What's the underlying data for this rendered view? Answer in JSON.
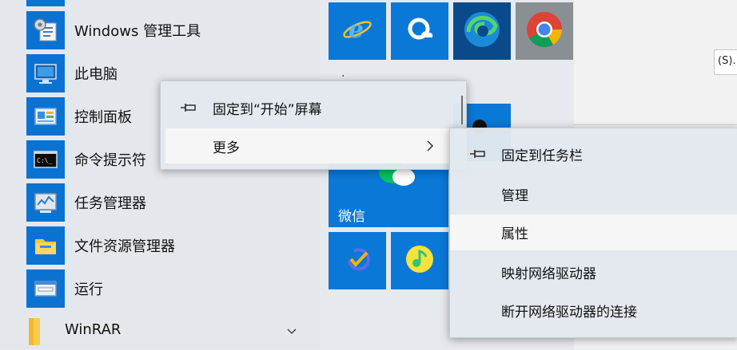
{
  "start_list": {
    "items": [
      {
        "label": "Windows 管理工具",
        "icon": "admin-tools-icon"
      },
      {
        "label": "此电脑",
        "icon": "this-pc-icon"
      },
      {
        "label": "控制面板",
        "icon": "control-panel-icon"
      },
      {
        "label": "命令提示符",
        "icon": "command-prompt-icon"
      },
      {
        "label": "任务管理器",
        "icon": "task-manager-icon"
      },
      {
        "label": "文件资源管理器",
        "icon": "file-explorer-icon"
      },
      {
        "label": "运行",
        "icon": "run-icon"
      }
    ],
    "folder": {
      "label": "WinRAR",
      "icon": "folder-icon"
    }
  },
  "tiles": {
    "wechat_label": "微信",
    "dot": "."
  },
  "background_window": {
    "field_text": "(S)."
  },
  "context_menu": {
    "items": [
      {
        "label": "固定到“开始”屏幕",
        "icon": "pin-icon"
      },
      {
        "label": "更多",
        "icon": "chevron-right-icon"
      }
    ]
  },
  "submenu": {
    "items": [
      {
        "label": "固定到任务栏",
        "icon": "pin-icon"
      },
      {
        "label": "管理"
      },
      {
        "label": "属性"
      },
      {
        "label": "映射网络驱动器"
      },
      {
        "label": "断开网络驱动器的连接"
      }
    ]
  },
  "colors": {
    "tile_blue": "#0a78d7",
    "menu_bg": "#e2e8ee",
    "hover": "#f6f6f6",
    "wechat_green": "#07c160"
  }
}
